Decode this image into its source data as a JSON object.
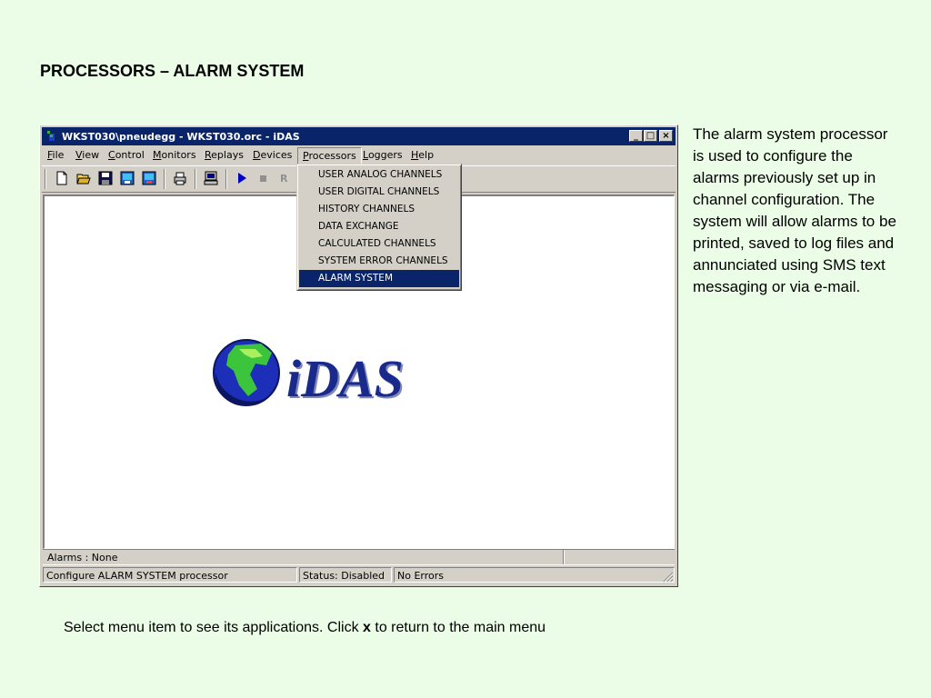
{
  "slide": {
    "title": "PROCESSORS – ALARM SYSTEM",
    "description": "The alarm system processor is used to configure the alarms previously set up in channel configuration. The system will allow alarms to be printed, saved to log files and annunciated using SMS text messaging or via e-mail.",
    "footer_before": "Select menu item to see its applications. Click ",
    "footer_key": "x",
    "footer_after": " to return to the main menu"
  },
  "window": {
    "title": "WKST030\\pneudegg - WKST030.orc - iDAS",
    "controls": {
      "minimize": "_",
      "maximize": "□",
      "close": "×"
    }
  },
  "menubar": {
    "items": [
      {
        "label": "File",
        "accel": "F",
        "rest": "ile"
      },
      {
        "label": "View",
        "accel": "V",
        "rest": "iew"
      },
      {
        "label": "Control",
        "accel": "C",
        "rest": "ontrol"
      },
      {
        "label": "Monitors",
        "accel": "M",
        "rest": "onitors"
      },
      {
        "label": "Replays",
        "accel": "R",
        "rest": "eplays"
      },
      {
        "label": "Devices",
        "accel": "D",
        "rest": "evices"
      },
      {
        "label": "Processors",
        "accel": "P",
        "rest": "rocessors"
      },
      {
        "label": "Loggers",
        "accel": "L",
        "rest": "oggers"
      },
      {
        "label": "Help",
        "accel": "H",
        "rest": "elp"
      }
    ]
  },
  "toolbar": {
    "icons": [
      "new-icon",
      "open-icon",
      "save-icon",
      "monitor-in-icon",
      "monitor-out-icon",
      "print-icon",
      "computer-icon",
      "play-icon",
      "stop-icon",
      "record-icon"
    ],
    "record_label": "R"
  },
  "processors_menu": {
    "items": [
      "USER ANALOG CHANNELS",
      "USER DIGITAL CHANNELS",
      "HISTORY CHANNELS",
      "DATA EXCHANGE",
      "CALCULATED CHANNELS",
      "SYSTEM ERROR CHANNELS",
      "ALARM SYSTEM"
    ],
    "selected_index": 6
  },
  "logo": {
    "text": "iDAS"
  },
  "alarm_bar": {
    "text": "Alarms :  None"
  },
  "status": {
    "message": "Configure ALARM SYSTEM processor",
    "state": "Status: Disabled",
    "errors": "No Errors"
  },
  "colors": {
    "background": "#ebfde6",
    "titlebar": "#0a246a",
    "selection": "#0a246a",
    "logo_text": "#1a2a8c"
  }
}
